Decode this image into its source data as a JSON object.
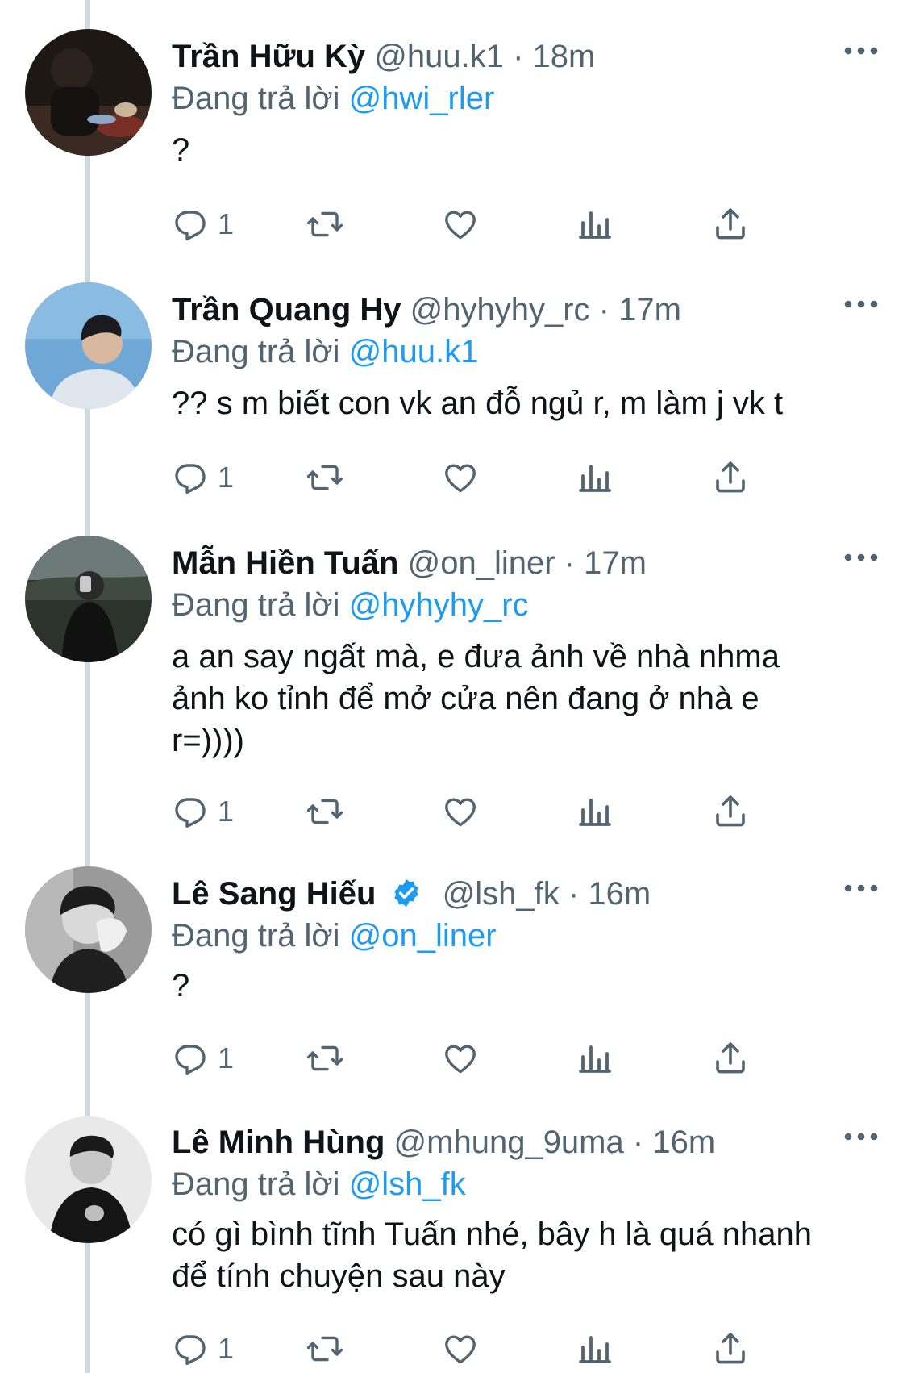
{
  "tweets": [
    {
      "name": "Trần Hữu Kỳ",
      "handle": "@huu.k1",
      "separator": "·",
      "time": "18m",
      "replying_label": "Đang trả lời",
      "replying_to": "@hwi_rler",
      "text": "?",
      "reply_count": "1",
      "verified": false
    },
    {
      "name": "Trần Quang Hy",
      "handle": "@hyhyhy_rc",
      "separator": "·",
      "time": "17m",
      "replying_label": "Đang trả lời",
      "replying_to": "@huu.k1",
      "text": "?? s m biết con vk an đỗ ngủ r, m làm j vk t",
      "reply_count": "1",
      "verified": false
    },
    {
      "name": "Mẫn Hiền Tuấn",
      "handle": "@on_liner",
      "separator": "·",
      "time": "17m",
      "replying_label": "Đang trả lời",
      "replying_to": "@hyhyhy_rc",
      "text": "a an say ngất mà, e đưa ảnh về nhà nhma\nảnh ko tỉnh để mở cửa nên đang ở nhà e\nr=))))",
      "reply_count": "1",
      "verified": false
    },
    {
      "name": "Lê Sang Hiếu",
      "handle": "@lsh_fk",
      "separator": "·",
      "time": "16m",
      "replying_label": "Đang trả lời",
      "replying_to": "@on_liner",
      "text": "?",
      "reply_count": "1",
      "verified": true
    },
    {
      "name": "Lê Minh Hùng",
      "handle": "@mhung_9uma",
      "separator": "·",
      "time": "16m",
      "replying_label": "Đang trả lời",
      "replying_to": "@lsh_fk",
      "text": "có gì bình tĩnh Tuấn nhé, bây h là quá nhanh\nđể tính chuyện sau này",
      "reply_count": "1",
      "verified": false
    }
  ],
  "icons": {
    "reply": "reply-icon",
    "retweet": "retweet-icon",
    "like": "like-icon",
    "views": "views-icon",
    "share": "share-icon",
    "more": "more-icon",
    "verified": "verified-badge-icon"
  },
  "colors": {
    "link": "#1d9bf0",
    "secondary_text": "#536471",
    "icon": "#536471",
    "thread_line": "#cfd9de"
  }
}
